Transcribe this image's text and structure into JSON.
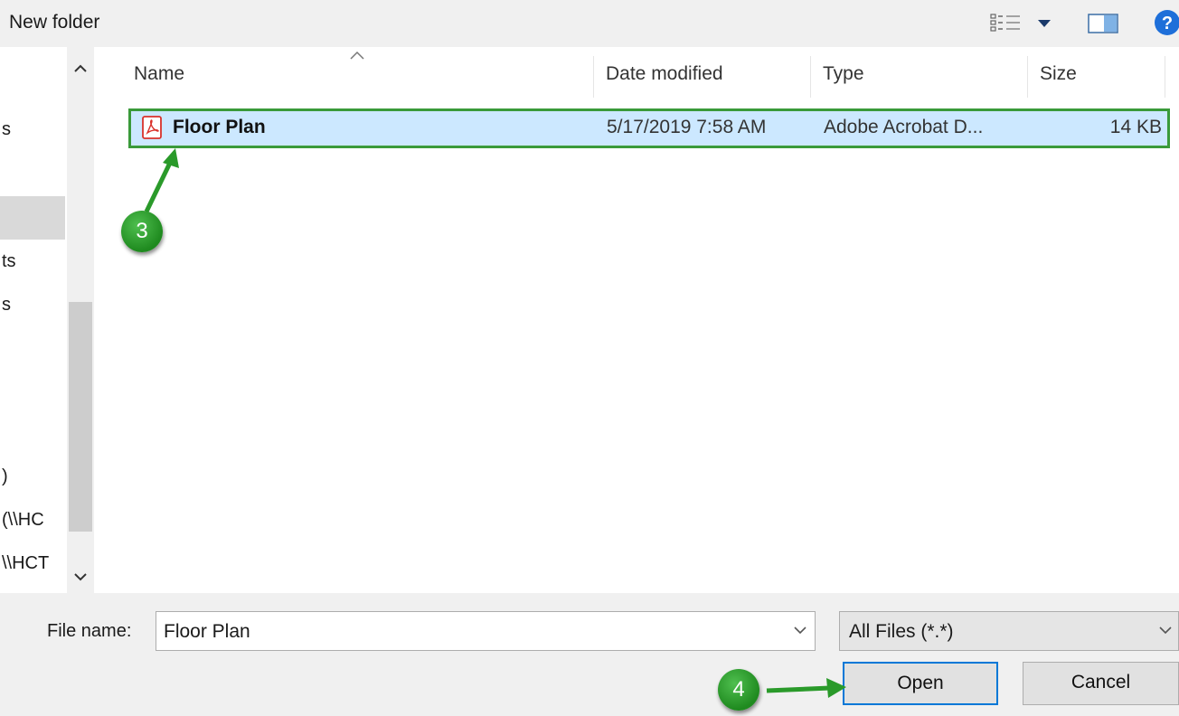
{
  "toolbar": {
    "new_folder_label": "New folder",
    "help_glyph": "?"
  },
  "nav": {
    "items": [
      {
        "label": "s"
      },
      {
        "label": "ts"
      },
      {
        "label": "s"
      },
      {
        "label": ")"
      },
      {
        "label": "(\\\\HC"
      },
      {
        "label": "\\\\HCT"
      }
    ]
  },
  "columns": {
    "name": "Name",
    "date": "Date modified",
    "type": "Type",
    "size": "Size"
  },
  "files": [
    {
      "name": "Floor Plan",
      "date": "5/17/2019 7:58 AM",
      "type": "Adobe Acrobat D...",
      "size": "14 KB",
      "icon": "pdf-icon",
      "selected": true
    }
  ],
  "bottom": {
    "file_name_label": "File name:",
    "file_name_value": "Floor Plan",
    "file_type_value": "All Files (*.*)",
    "open_label": "Open",
    "cancel_label": "Cancel"
  },
  "callouts": {
    "step3": "3",
    "step4": "4"
  },
  "colors": {
    "selection": "#cce8ff",
    "highlight_border": "#3a9a3a",
    "callout": "#2a9a2a",
    "open_button_border": "#0078d7"
  }
}
